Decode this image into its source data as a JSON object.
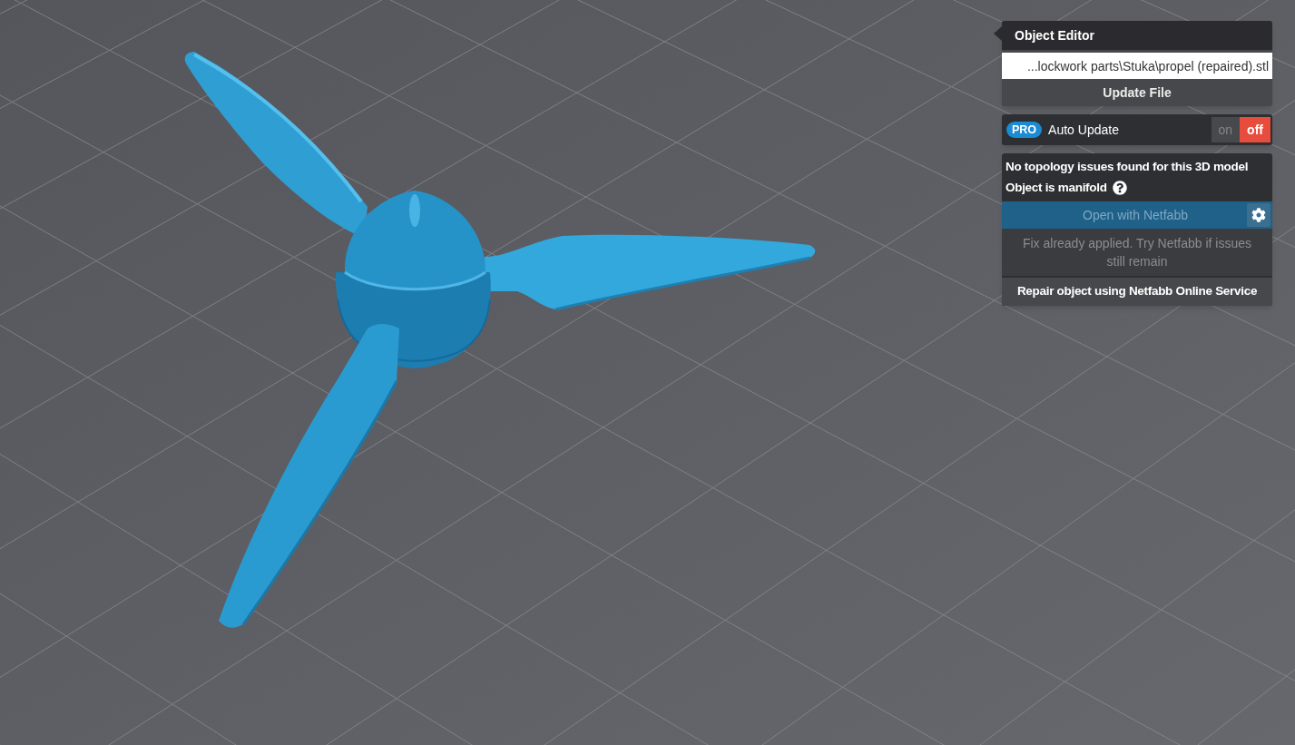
{
  "object_editor": {
    "title": "Object Editor",
    "file_path": {
      "value": "...lockwork parts\\Stuka\\propel (repaired).stl"
    },
    "update_button": "Update File",
    "auto_update": {
      "badge": "PRO",
      "label": "Auto Update",
      "options": [
        {
          "label": "on",
          "selected": false
        },
        {
          "label": "off",
          "selected": true
        }
      ]
    },
    "topology": {
      "status": "No topology issues found for this 3D model",
      "manifold": "Object is manifold",
      "open_button": {
        "label": "Open with Netfabb",
        "disabled": true
      },
      "note": "Fix already applied. Try Netfabb if issues still remain",
      "repair_button": "Repair object using Netfabb Online Service"
    }
  }
}
